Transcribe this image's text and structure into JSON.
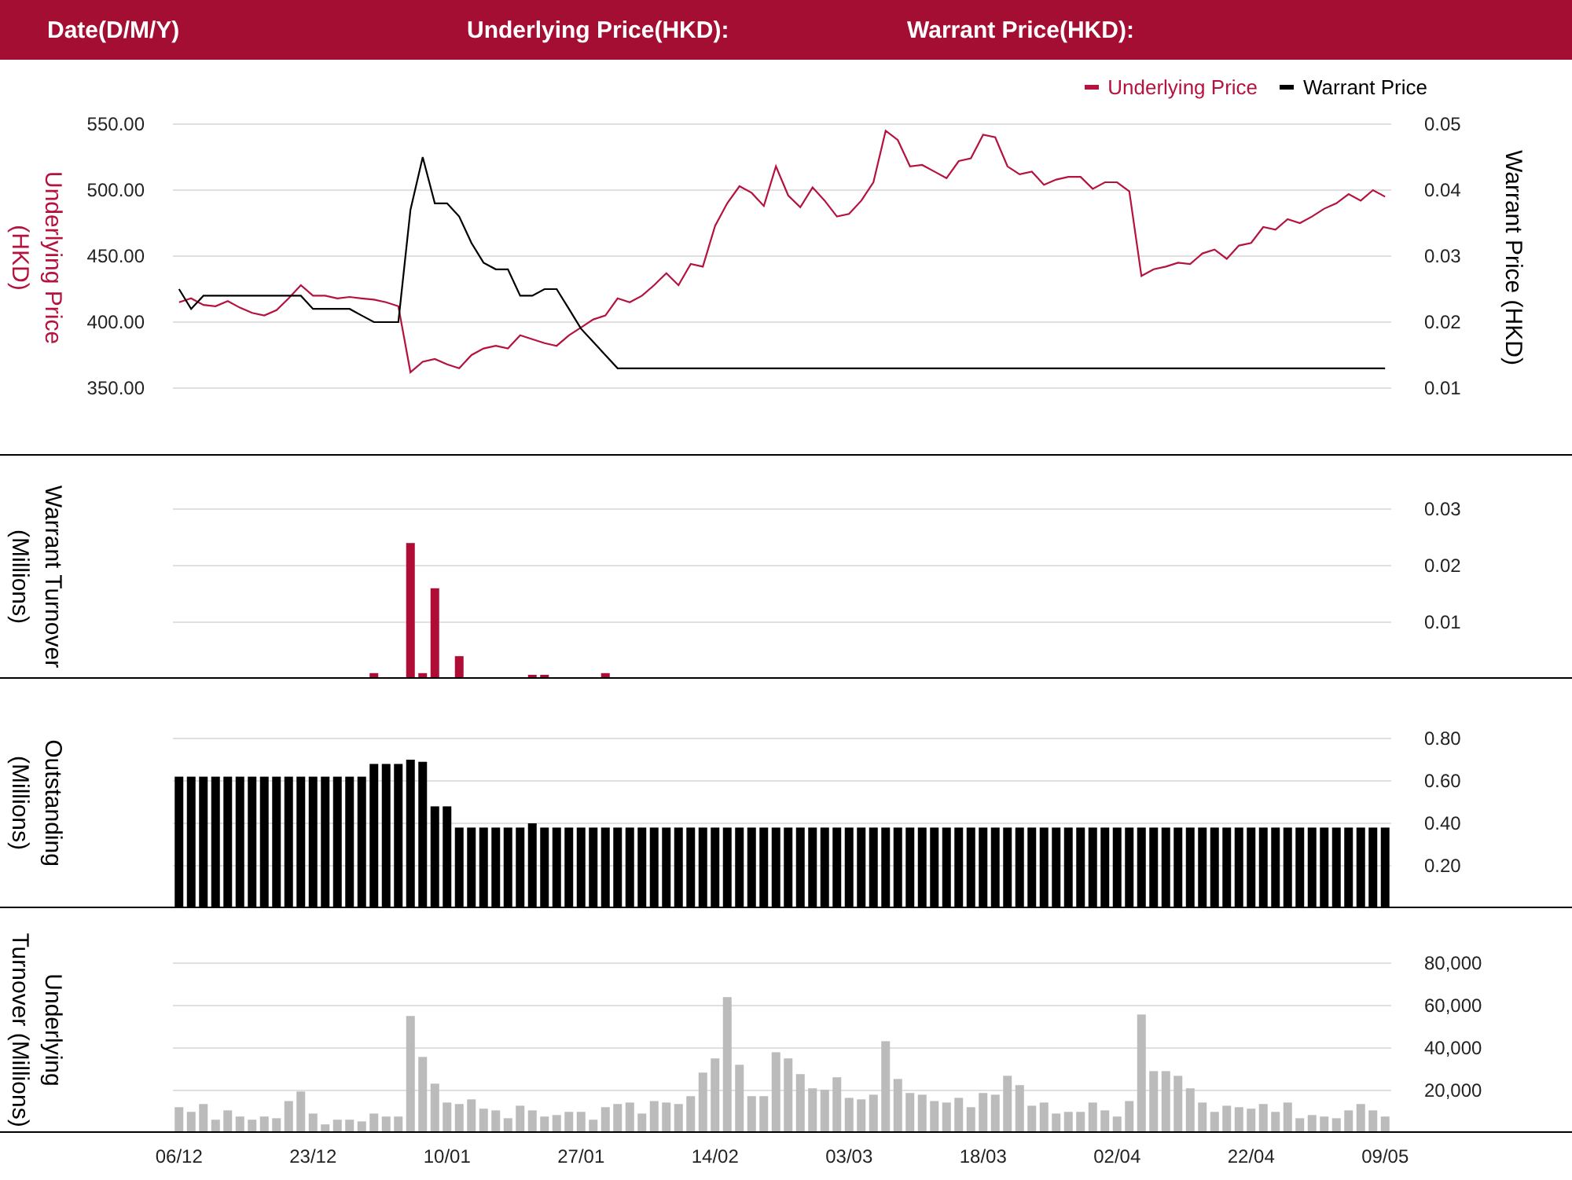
{
  "header": [
    "Date(D/M/Y)",
    "Underlying Price(HKD):",
    "Warrant Price(HKD):"
  ],
  "price_chart": {
    "chart_data": {
      "type": "line",
      "grid": true,
      "legend": true,
      "ylabel": "Underlying Price\n(HKD)",
      "ylim": [
        350,
        550
      ],
      "yticks": [
        {
          "value": 550,
          "label": "550.00"
        },
        {
          "value": 500,
          "label": "500.00"
        },
        {
          "value": 450,
          "label": "450.00"
        },
        {
          "value": 400,
          "label": "400.00"
        },
        {
          "value": 350,
          "label": "350.00"
        }
      ],
      "y2label": "Warrant Price (HKD)",
      "y2lim": [
        0.01,
        0.05
      ],
      "y2ticks": [
        {
          "value": 0.05,
          "label": "0.05"
        },
        {
          "value": 0.04,
          "label": "0.04"
        },
        {
          "value": 0.03,
          "label": "0.03"
        },
        {
          "value": 0.02,
          "label": "0.02"
        },
        {
          "value": 0.01,
          "label": "0.01"
        }
      ],
      "series": [
        {
          "name": "Underlying Price",
          "color": "#b5123e",
          "values": [
            415,
            418,
            413,
            412,
            416,
            411,
            407,
            405,
            409,
            418,
            428,
            420,
            420,
            418,
            419,
            418,
            417,
            415,
            412,
            362,
            370,
            372,
            368,
            365,
            375,
            380,
            382,
            380,
            390,
            387,
            384,
            382,
            390,
            396,
            402,
            405,
            418,
            415,
            420,
            428,
            437,
            428,
            444,
            442,
            473,
            490,
            503,
            498,
            488,
            518,
            496,
            487,
            502,
            492,
            480,
            482,
            492,
            506,
            545,
            538,
            518,
            519,
            514,
            509,
            522,
            524,
            542,
            540,
            518,
            512,
            514,
            504,
            508,
            510,
            510,
            501,
            506,
            506,
            499,
            435,
            440,
            442,
            445,
            444,
            452,
            455,
            448,
            458,
            460,
            472,
            470,
            478,
            475,
            480,
            486,
            490,
            497,
            492,
            500,
            495
          ]
        },
        {
          "name": "Warrant Price",
          "color": "#000000",
          "axis": "y2",
          "values": [
            0.025,
            0.022,
            0.024,
            0.024,
            0.024,
            0.024,
            0.024,
            0.024,
            0.024,
            0.024,
            0.024,
            0.022,
            0.022,
            0.022,
            0.022,
            0.021,
            0.02,
            0.02,
            0.02,
            0.037,
            0.045,
            0.038,
            0.038,
            0.036,
            0.032,
            0.029,
            0.028,
            0.028,
            0.024,
            0.024,
            0.025,
            0.025,
            0.022,
            0.019,
            0.017,
            0.015,
            0.013,
            0.013,
            0.013,
            0.013,
            0.013,
            0.013,
            0.013,
            0.013,
            0.013,
            0.013,
            0.013,
            0.013,
            0.013,
            0.013,
            0.013,
            0.013,
            0.013,
            0.013,
            0.013,
            0.013,
            0.013,
            0.013,
            0.013,
            0.013,
            0.013,
            0.013,
            0.013,
            0.013,
            0.013,
            0.013,
            0.013,
            0.013,
            0.013,
            0.013,
            0.013,
            0.013,
            0.013,
            0.013,
            0.013,
            0.013,
            0.013,
            0.013,
            0.013,
            0.013,
            0.013,
            0.013,
            0.013,
            0.013,
            0.013,
            0.013,
            0.013,
            0.013,
            0.013,
            0.013,
            0.013,
            0.013,
            0.013,
            0.013,
            0.013,
            0.013,
            0.013,
            0.013,
            0.013,
            0.013
          ]
        }
      ]
    }
  },
  "warrant_turnover_chart": {
    "chart_data": {
      "type": "bar",
      "grid": true,
      "ylabel": "Warrant Turnover\n(Millions)",
      "ylim": [
        0,
        0.03
      ],
      "yticks": [
        {
          "value": 0.03,
          "label": "0.03"
        },
        {
          "value": 0.02,
          "label": "0.02"
        },
        {
          "value": 0.01,
          "label": "0.01"
        }
      ],
      "values": [
        0,
        0,
        0,
        0,
        0,
        0,
        0,
        0,
        0,
        0,
        0,
        0,
        0,
        0,
        0,
        0,
        0.001,
        0,
        0,
        0.024,
        0.001,
        0.016,
        0,
        0.004,
        0,
        0,
        0,
        0,
        0,
        0.0007,
        0.0007,
        0,
        0,
        0,
        0,
        0.001,
        0,
        0,
        0,
        0,
        0,
        0,
        0,
        0,
        0,
        0,
        0,
        0,
        0,
        0,
        0,
        0,
        0,
        0,
        0,
        0,
        0,
        0,
        0,
        0,
        0,
        0,
        0,
        0,
        0,
        0,
        0,
        0,
        0,
        0,
        0,
        0,
        0,
        0,
        0,
        0,
        0,
        0,
        0,
        0,
        0,
        0,
        0,
        0,
        0,
        0,
        0,
        0,
        0,
        0,
        0,
        0,
        0,
        0,
        0,
        0,
        0,
        0,
        0,
        0
      ]
    }
  },
  "outstanding_chart": {
    "chart_data": {
      "type": "bar",
      "grid": true,
      "ylabel": "Outstanding\n(Millions)",
      "ylim": [
        0,
        0.8
      ],
      "yticks": [
        {
          "value": 0.8,
          "label": "0.80"
        },
        {
          "value": 0.6,
          "label": "0.60"
        },
        {
          "value": 0.4,
          "label": "0.40"
        },
        {
          "value": 0.2,
          "label": "0.20"
        }
      ],
      "values": [
        0.62,
        0.62,
        0.62,
        0.62,
        0.62,
        0.62,
        0.62,
        0.62,
        0.62,
        0.62,
        0.62,
        0.62,
        0.62,
        0.62,
        0.62,
        0.62,
        0.68,
        0.68,
        0.68,
        0.7,
        0.69,
        0.48,
        0.48,
        0.38,
        0.38,
        0.38,
        0.38,
        0.38,
        0.38,
        0.4,
        0.38,
        0.38,
        0.38,
        0.38,
        0.38,
        0.38,
        0.38,
        0.38,
        0.38,
        0.38,
        0.38,
        0.38,
        0.38,
        0.38,
        0.38,
        0.38,
        0.38,
        0.38,
        0.38,
        0.38,
        0.38,
        0.38,
        0.38,
        0.38,
        0.38,
        0.38,
        0.38,
        0.38,
        0.38,
        0.38,
        0.38,
        0.38,
        0.38,
        0.38,
        0.38,
        0.38,
        0.38,
        0.38,
        0.38,
        0.38,
        0.38,
        0.38,
        0.38,
        0.38,
        0.38,
        0.38,
        0.38,
        0.38,
        0.38,
        0.38,
        0.38,
        0.38,
        0.38,
        0.38,
        0.38,
        0.38,
        0.38,
        0.38,
        0.38,
        0.38,
        0.38,
        0.38,
        0.38,
        0.38,
        0.38,
        0.38,
        0.38,
        0.38,
        0.38,
        0.38
      ]
    }
  },
  "underlying_turnover_chart": {
    "chart_data": {
      "type": "bar",
      "grid": true,
      "ylabel": "Underlying\nTurnover (Millions)",
      "ylim": [
        0,
        80000
      ],
      "yticks": [
        {
          "value": 80000,
          "label": "80,000"
        },
        {
          "value": 60000,
          "label": "60,000"
        },
        {
          "value": 40000,
          "label": "40,000"
        },
        {
          "value": 20000,
          "label": "20,000"
        }
      ],
      "values": [
        12100,
        9900,
        13600,
        6200,
        10600,
        7700,
        6200,
        7700,
        6900,
        15000,
        19500,
        9100,
        4000,
        6200,
        6200,
        5400,
        9100,
        7700,
        7700,
        55100,
        35800,
        23200,
        14300,
        13600,
        15800,
        11400,
        10600,
        6900,
        12800,
        10600,
        7700,
        8400,
        9900,
        9900,
        6200,
        12100,
        13600,
        14300,
        9100,
        15000,
        14300,
        13600,
        17300,
        28400,
        35100,
        64000,
        32100,
        17300,
        17300,
        38000,
        35100,
        27700,
        21000,
        20300,
        26200,
        16500,
        15800,
        18000,
        43200,
        25400,
        18800,
        18000,
        15000,
        14300,
        16500,
        12100,
        18800,
        18000,
        26900,
        22500,
        12800,
        14300,
        9100,
        9900,
        9900,
        14300,
        10600,
        7700,
        15000,
        55800,
        29100,
        29100,
        26900,
        21000,
        14300,
        9900,
        12800,
        12100,
        11400,
        13600,
        9900,
        14300,
        6900,
        8400,
        7700,
        6900,
        10600,
        13600,
        10600,
        7700
      ]
    },
    "x_axis_labels": [
      "06/12",
      "23/12",
      "10/01",
      "27/01",
      "14/02",
      "03/03",
      "18/03",
      "02/04",
      "22/04",
      "09/05"
    ]
  }
}
